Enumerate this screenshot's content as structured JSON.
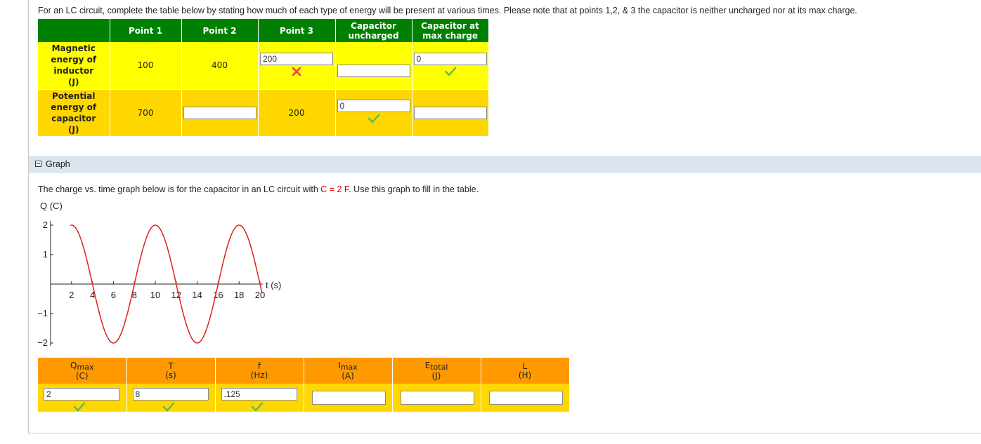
{
  "intro": "For an LC circuit, complete the table below by stating how much of each type of energy will be present at various times. Please note that at points 1,2, & 3 the capacitor is neither uncharged nor at its max charge.",
  "energy_table": {
    "headers": [
      "Point 1",
      "Point 2",
      "Point 3",
      "Capacitor uncharged",
      "Capacitor at max charge"
    ],
    "rows": [
      {
        "label": "Magnetic energy of inductor (J)",
        "point1": "100",
        "point2": "400",
        "point3_input": "200",
        "point3_status": "incorrect",
        "uncharged_input": "",
        "max_charge_input": "0",
        "max_charge_status": "correct"
      },
      {
        "label": "Potential energy of capacitor (J)",
        "point1": "700",
        "point2_input": "",
        "point3": "200",
        "uncharged_input": "0",
        "uncharged_status": "correct",
        "max_charge_input": ""
      }
    ]
  },
  "graph_section": {
    "title": "Graph",
    "desc_before": "The charge vs. time graph below is for the capacitor in an LC circuit with ",
    "desc_highlight": "C = 2 F",
    "desc_after": ". Use this graph to fill in the table."
  },
  "chart_data": {
    "type": "line",
    "ylabel": "Q (C)",
    "xlabel": "t (s)",
    "xlim": [
      0,
      20
    ],
    "ylim": [
      -2,
      2
    ],
    "x_ticks": [
      2,
      4,
      6,
      8,
      10,
      12,
      14,
      16,
      18,
      20
    ],
    "y_ticks": [
      2,
      1,
      -1,
      -2
    ],
    "y_tick_labels": [
      "2",
      "1",
      "−1",
      "−2"
    ],
    "series": [
      {
        "function": "Q = 2 sin(2π t / 8)",
        "amplitude": 2,
        "period": 8,
        "t_start": 1.9,
        "t_end": 20.2
      }
    ],
    "grid": false,
    "line_color": "#e0201a"
  },
  "results_table": {
    "headers": [
      {
        "main": "Q",
        "sub": "max",
        "unit": "(C)"
      },
      {
        "main": "T",
        "sub": "",
        "unit": "(s)"
      },
      {
        "main": "f",
        "sub": "",
        "unit": "(Hz)"
      },
      {
        "main": "I",
        "sub": "max",
        "unit": "(A)"
      },
      {
        "main": "E",
        "sub": "total",
        "unit": "(J)"
      },
      {
        "main": "L",
        "sub": "",
        "unit": "(H)"
      }
    ],
    "inputs": [
      {
        "value": "2",
        "status": "correct"
      },
      {
        "value": "8",
        "status": "correct"
      },
      {
        "value": ".125",
        "status": "correct"
      },
      {
        "value": "",
        "status": ""
      },
      {
        "value": "",
        "status": ""
      },
      {
        "value": "",
        "status": ""
      }
    ]
  },
  "colors": {
    "header_green": "#008000",
    "row_yellow": "#ffff00",
    "row_gold": "#ffd700",
    "results_header_orange": "#ff9900",
    "check_green": "#5cb85c",
    "cross_red": "#e8463c",
    "graph_bar": "#dbe5ef"
  }
}
